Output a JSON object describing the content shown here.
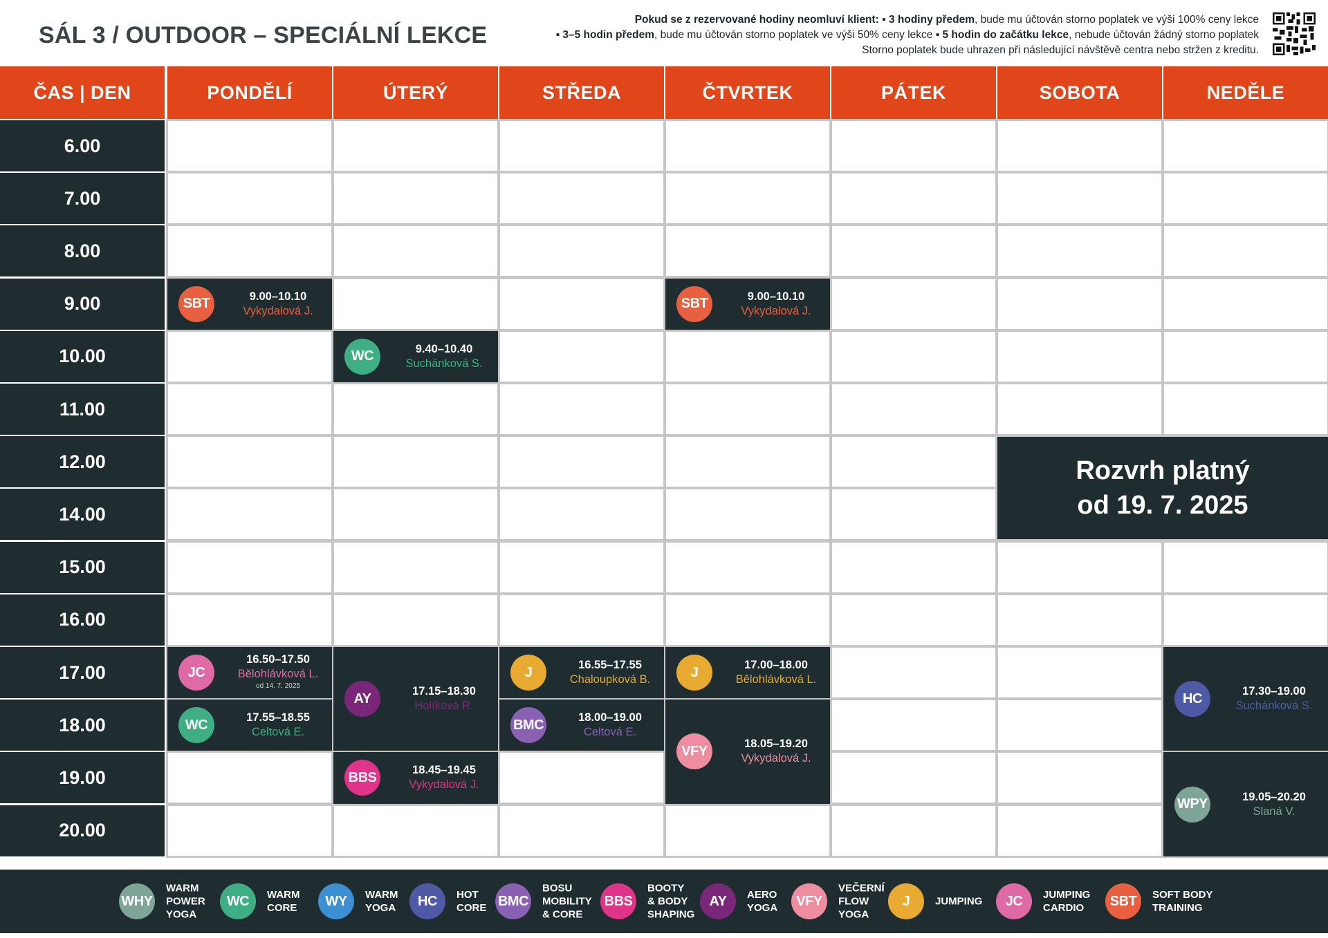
{
  "title": "SÁL  3 / OUTDOOR – SPECIÁLNÍ LEKCE",
  "notice": {
    "line1_bold": "Pokud se z rezervované hodiny neomluví klient:",
    "line1_b2": "▪ 3 hodiny předem",
    "line1_rest": ", bude mu účtován storno poplatek ve výši 100% ceny lekce",
    "line2_b1": "▪ 3–5 hodin předem",
    "line2_mid": ", bude mu účtován storno poplatek ve výši 50% ceny lekce ",
    "line2_b2": "▪ 5 hodin do začátku lekce",
    "line2_rest": ", nebude účtován žádný storno poplatek",
    "line3": "Storno poplatek bude uhrazen při následující návštěvě centra nebo stržen z kreditu."
  },
  "header": {
    "time_day": "ČAS | DEN",
    "days": [
      "PONDĚLÍ",
      "ÚTERÝ",
      "STŘEDA",
      "ČTVRTEK",
      "PÁTEK",
      "SOBOTA",
      "NEDĚLE"
    ]
  },
  "times": [
    "6.00",
    "7.00",
    "8.00",
    "9.00",
    "10.00",
    "11.00",
    "12.00",
    "14.00",
    "15.00",
    "16.00",
    "17.00",
    "18.00",
    "19.00",
    "20.00"
  ],
  "colors": {
    "accent": "#e1461a",
    "dark": "#1f2d30",
    "SBT": "#e8603f",
    "WC": "#3fae84",
    "JC": "#de6aa6",
    "AY": "#7a2679",
    "BBS": "#e0338a",
    "J": "#e8aa30",
    "BMC": "#8a60b2",
    "VFY": "#ef8da0",
    "HC": "#4f5aa6",
    "WPY": "#7ea597",
    "WY": "#3d8fd4"
  },
  "lessons": [
    {
      "code": "SBT",
      "time": "9.00–10.10",
      "teacher": "Vykydalová J.",
      "note": ""
    },
    {
      "code": "SBT",
      "time": "9.00–10.10",
      "teacher": "Vykydalová J.",
      "note": ""
    },
    {
      "code": "WC",
      "time": "9.40–10.40",
      "teacher": "Suchánková S.",
      "note": ""
    },
    {
      "code": "JC",
      "time": "16.50–17.50",
      "teacher": "Bělohlávková L.",
      "note": "od 14. 7. 2025"
    },
    {
      "code": "WC",
      "time": "17.55–18.55",
      "teacher": "Celtová E.",
      "note": ""
    },
    {
      "code": "AY",
      "time": "17.15–18.30",
      "teacher": "Holíková R.",
      "note": ""
    },
    {
      "code": "BBS",
      "time": "18.45–19.45",
      "teacher": "Vykydalová J.",
      "note": ""
    },
    {
      "code": "J",
      "time": "16.55–17.55",
      "teacher": "Chaloupková B.",
      "note": ""
    },
    {
      "code": "BMC",
      "time": "18.00–19.00",
      "teacher": "Celtová E.",
      "note": ""
    },
    {
      "code": "J",
      "time": "17.00–18.00",
      "teacher": "Bělohlávková L.",
      "note": ""
    },
    {
      "code": "VFY",
      "time": "18.05–19.20",
      "teacher": "Vykydalová J.",
      "note": ""
    },
    {
      "code": "HC",
      "time": "17.30–19.00",
      "teacher": "Suchánková S.",
      "note": ""
    },
    {
      "code": "WPY",
      "time": "19.05–20.20",
      "teacher": "Slaná V.",
      "note": ""
    }
  ],
  "validity": {
    "line1": "Rozvrh platný",
    "line2": "od 19. 7. 2025"
  },
  "legend": [
    {
      "code": "WHY",
      "label": "WARM\nPOWER\nYOGA",
      "color": "#7ea597"
    },
    {
      "code": "WC",
      "label": "WARM\nCORE",
      "color": "#3fae84"
    },
    {
      "code": "WY",
      "label": "WARM\nYOGA",
      "color": "#3d8fd4"
    },
    {
      "code": "HC",
      "label": "HOT\nCORE",
      "color": "#4f5aa6"
    },
    {
      "code": "BMC",
      "label": "BOSU\nMOBILITY\n& CORE",
      "color": "#8a60b2"
    },
    {
      "code": "BBS",
      "label": "BOOTY\n& BODY\nSHAPING",
      "color": "#e0338a"
    },
    {
      "code": "AY",
      "label": "AERO\nYOGA",
      "color": "#7a2679"
    },
    {
      "code": "VFY",
      "label": "VEČERNÍ\nFLOW\nYOGA",
      "color": "#ef8da0"
    },
    {
      "code": "J",
      "label": "JUMPING",
      "color": "#e8aa30"
    },
    {
      "code": "JC",
      "label": "JUMPING\nCARDIO",
      "color": "#de6aa6"
    },
    {
      "code": "SBT",
      "label": "SOFT BODY\nTRAINING",
      "color": "#e8603f"
    }
  ]
}
